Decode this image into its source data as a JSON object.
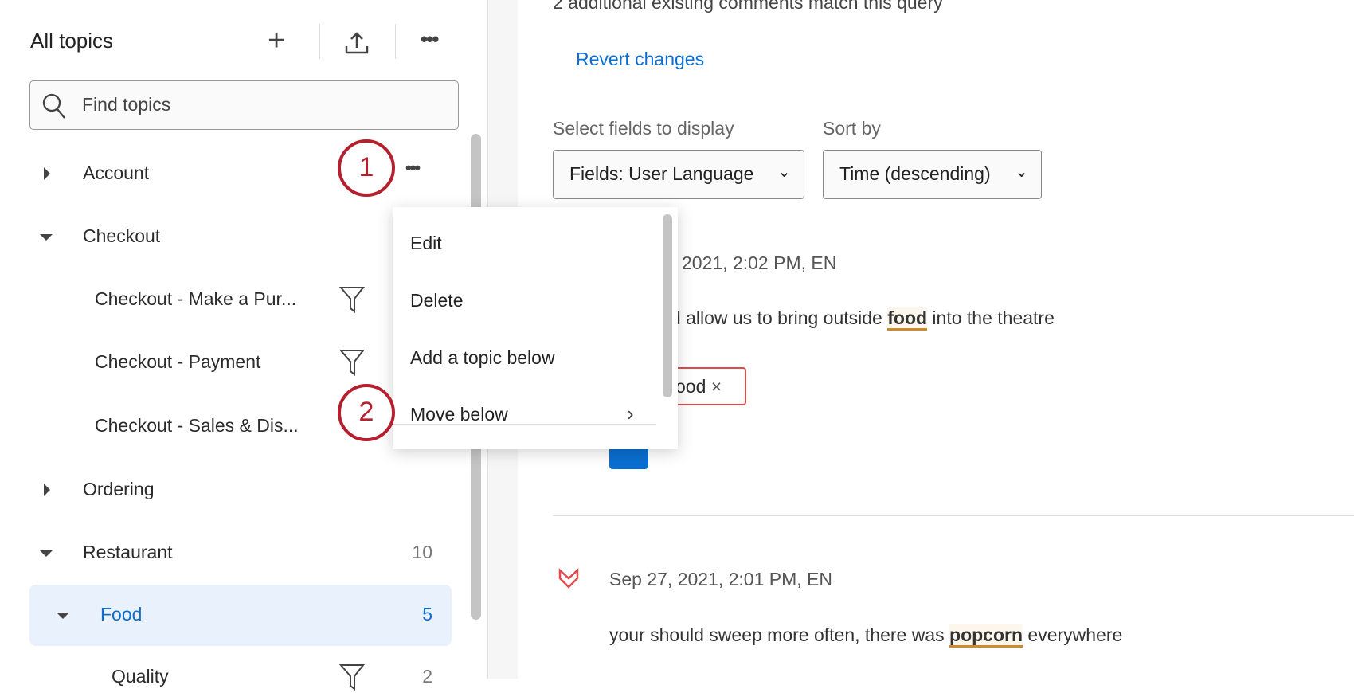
{
  "sidebar": {
    "title": "All topics",
    "search_placeholder": "Find topics",
    "items": [
      {
        "label": "Account",
        "expanded": false
      },
      {
        "label": "Checkout",
        "expanded": true
      },
      {
        "label": "Checkout - Make a Pur..."
      },
      {
        "label": "Checkout - Payment"
      },
      {
        "label": "Checkout - Sales & Dis..."
      },
      {
        "label": "Ordering",
        "expanded": false
      },
      {
        "label": "Restaurant",
        "count": "10",
        "expanded": true
      },
      {
        "label": "Food",
        "count": "5",
        "selected": true
      },
      {
        "label": "Quality",
        "count": "2"
      }
    ]
  },
  "steps": [
    "1",
    "2"
  ],
  "context_menu": {
    "items": [
      "Edit",
      "Delete",
      "Add a topic below",
      "Move below"
    ]
  },
  "main": {
    "match_text": "2 additional existing comments match this query",
    "revert_label": "Revert changes",
    "fields_label": "Select fields to display",
    "fields_value": "Fields: User Language",
    "sort_label": "Sort by",
    "sort_value": "Time (descending)",
    "comments": [
      {
        "date": "2021, 2:02 PM, EN",
        "text_before": "uld allow us to bring outside ",
        "highlight": "food",
        "text_after": " into the theatre",
        "tag": "ood"
      },
      {
        "date": "Sep 27, 2021, 2:01 PM, EN",
        "text_before": "your should sweep more often, there was ",
        "highlight": "popcorn",
        "text_after": " everywhere"
      }
    ]
  },
  "colors": {
    "accent": "#0b6ed0",
    "step": "#b5202e",
    "highlight_underline": "#d08a2a",
    "selected_bg": "#e8f1fc"
  }
}
